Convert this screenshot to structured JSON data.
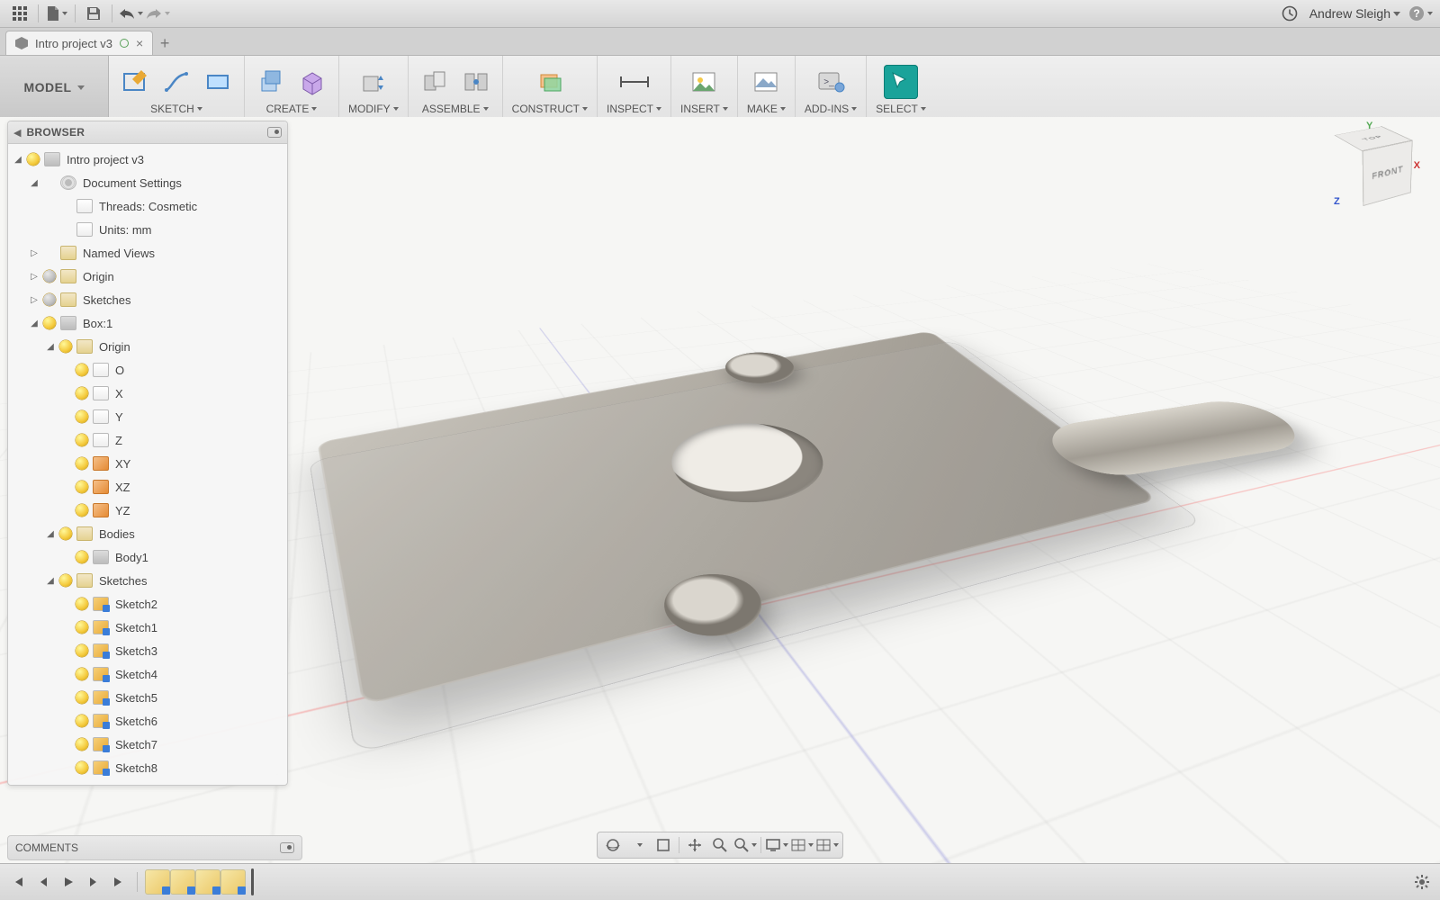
{
  "menubar": {
    "user_name": "Andrew Sleigh"
  },
  "tabs": {
    "active": "Intro project v3"
  },
  "ribbon": {
    "mode": "MODEL",
    "groups": [
      {
        "key": "sketch",
        "label": "SKETCH"
      },
      {
        "key": "create",
        "label": "CREATE"
      },
      {
        "key": "modify",
        "label": "MODIFY"
      },
      {
        "key": "assemble",
        "label": "ASSEMBLE"
      },
      {
        "key": "construct",
        "label": "CONSTRUCT"
      },
      {
        "key": "inspect",
        "label": "INSPECT"
      },
      {
        "key": "insert",
        "label": "INSERT"
      },
      {
        "key": "make",
        "label": "MAKE"
      },
      {
        "key": "addins",
        "label": "ADD-INS"
      },
      {
        "key": "select",
        "label": "SELECT"
      }
    ]
  },
  "viewcube": {
    "top": "TOP",
    "front": "FRONT",
    "right": ""
  },
  "browser": {
    "title": "BROWSER",
    "root": "Intro project v3",
    "doc_settings": "Document Settings",
    "threads": "Threads: Cosmetic",
    "units": "Units: mm",
    "named_views": "Named Views",
    "origin": "Origin",
    "sketches_top": "Sketches",
    "component": "Box:1",
    "comp_origin": "Origin",
    "origin_children": [
      "O",
      "X",
      "Y",
      "Z",
      "XY",
      "XZ",
      "YZ"
    ],
    "bodies": "Bodies",
    "body1": "Body1",
    "comp_sketches": "Sketches",
    "sketch_items": [
      "Sketch2",
      "Sketch1",
      "Sketch3",
      "Sketch4",
      "Sketch5",
      "Sketch6",
      "Sketch7",
      "Sketch8"
    ]
  },
  "comments": {
    "title": "COMMENTS"
  },
  "timeline": {
    "features": 4
  }
}
